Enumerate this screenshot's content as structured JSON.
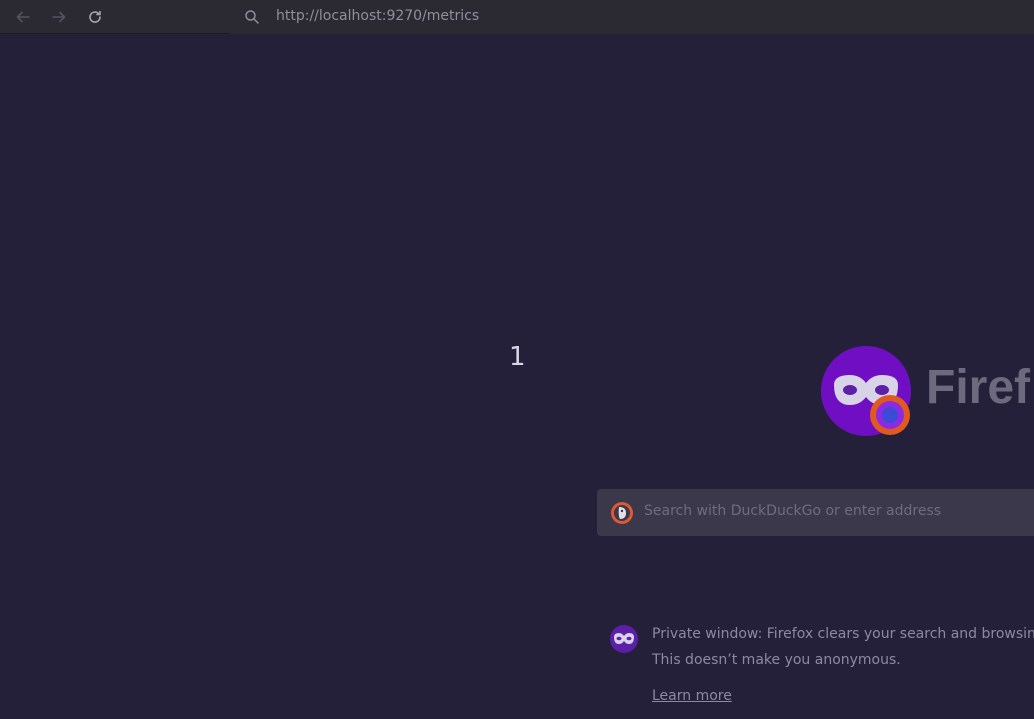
{
  "toolbar": {
    "url": "http://localhost:9270/metrics",
    "back_icon": "back-arrow-icon",
    "forward_icon": "forward-arrow-icon",
    "reload_icon": "reload-icon",
    "search_icon": "search-icon"
  },
  "page": {
    "body_text": "1"
  },
  "newtab": {
    "brand_text": "Firef",
    "search_placeholder": "Search with DuckDuckGo or enter address",
    "notice_line1": "Private window: Firefox clears your search and browsing h",
    "notice_line2": "This doesn’t make you anonymous.",
    "learn_more": "Learn more"
  },
  "colors": {
    "background": "#25203a",
    "toolbar": "#2b2a33",
    "private_purple": "#8000d7"
  }
}
